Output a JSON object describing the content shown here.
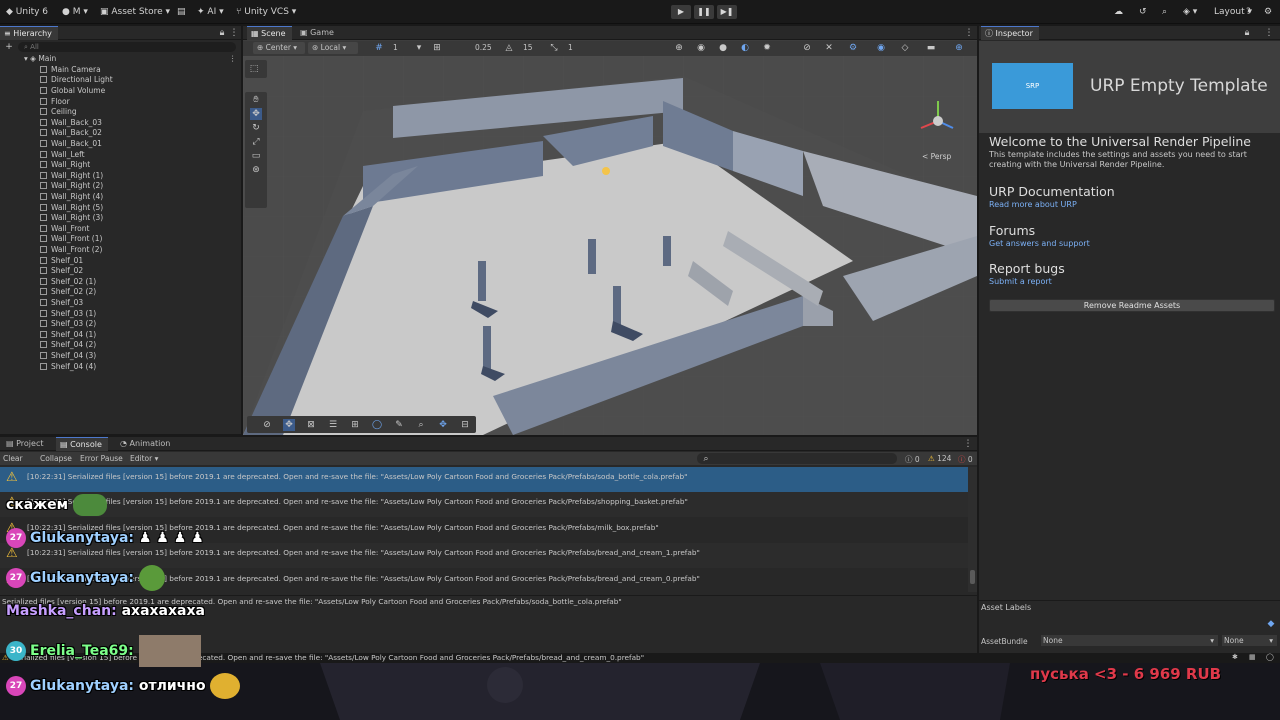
{
  "topbar": {
    "account": "Unity 6",
    "user": "M",
    "asset_store": "Asset Store",
    "ai": "AI",
    "vcs": "Unity VCS",
    "layout": "Layout"
  },
  "hierarchy": {
    "tab": "Hierarchy",
    "search_placeholder": "All",
    "scene": "Main",
    "items": [
      "Main Camera",
      "Directional Light",
      "Global Volume",
      "Floor",
      "Ceiling",
      "Wall_Back_03",
      "Wall_Back_02",
      "Wall_Back_01",
      "Wall_Left",
      "Wall_Right",
      "Wall_Right (1)",
      "Wall_Right (2)",
      "Wall_Right (4)",
      "Wall_Right (5)",
      "Wall_Right (3)",
      "Wall_Front",
      "Wall_Front (1)",
      "Wall_Front (2)",
      "Shelf_01",
      "Shelf_02",
      "Shelf_02 (1)",
      "Shelf_02 (2)",
      "Shelf_03",
      "Shelf_03 (1)",
      "Shelf_03 (2)",
      "Shelf_04 (1)",
      "Shelf_04 (2)",
      "Shelf_04 (3)",
      "Shelf_04 (4)"
    ]
  },
  "scene_view": {
    "tab_scene": "Scene",
    "tab_game": "Game",
    "pivot": "Center",
    "space": "Local",
    "grid_value": "1",
    "snap_value": "0.25",
    "rotate_value": "15",
    "scale_value": "1",
    "persp": "< Persp"
  },
  "inspector": {
    "tab": "Inspector",
    "thumb_label": "SRP",
    "title": "URP Empty Template",
    "welcome_heading": "Welcome to the Universal Render Pipeline",
    "welcome_body": "This template includes the settings and assets you need to start creating with the Universal Render Pipeline.",
    "sections": [
      {
        "heading": "URP Documentation",
        "link": "Read more about URP"
      },
      {
        "heading": "Forums",
        "link": "Get answers and support"
      },
      {
        "heading": "Report bugs",
        "link": "Submit a report"
      }
    ],
    "remove_button": "Remove Readme Assets",
    "asset_labels": "Asset Labels",
    "asset_bundle_label": "AssetBundle",
    "asset_bundle_value": "None",
    "asset_variant_value": "None"
  },
  "console": {
    "tab_project": "Project",
    "tab_console": "Console",
    "tab_animation": "Animation",
    "clear": "Clear",
    "collapse": "Collapse",
    "error_pause": "Error Pause",
    "editor": "Editor",
    "count_info": "0",
    "count_warn": "124",
    "count_error": "0",
    "messages": [
      "[10:22:31] Serialized files [version 15] before 2019.1 are deprecated. Open and re-save the file: \"Assets/Low Poly Cartoon Food and Groceries Pack/Prefabs/soda_bottle_cola.prefab\"",
      "[10:22:31] Serialized files [version 15] before 2019.1 are deprecated. Open and re-save the file: \"Assets/Low Poly Cartoon Food and Groceries Pack/Prefabs/shopping_basket.prefab\"",
      "[10:22:31] Serialized files [version 15] before 2019.1 are deprecated. Open and re-save the file: \"Assets/Low Poly Cartoon Food and Groceries Pack/Prefabs/milk_box.prefab\"",
      "[10:22:31] Serialized files [version 15] before 2019.1 are deprecated. Open and re-save the file: \"Assets/Low Poly Cartoon Food and Groceries Pack/Prefabs/bread_and_cream_1.prefab\"",
      "[10:22:31] Serialized files [version 15] before 2019.1 are deprecated. Open and re-save the file: \"Assets/Low Poly Cartoon Food and Groceries Pack/Prefabs/bread_and_cream_0.prefab\""
    ],
    "detail": "Serialized files [version 15] before 2019.1 are deprecated. Open and re-save the file: \"Assets/Low Poly Cartoon Food and Groceries Pack/Prefabs/soda_bottle_cola.prefab\"",
    "status": "Serialized files [version 15] before 2019.1 are deprecated. Open and re-save the file: \"Assets/Low Poly Cartoon Food and Groceries Pack/Prefabs/bread_and_cream_0.prefab\""
  },
  "chat": {
    "msg1_text": "скажем",
    "msg2_badge": "27",
    "msg2_user": "Glukanytaya:",
    "msg3_badge": "27",
    "msg3_user": "Glukanytaya:",
    "msg4_user": "Mashka_chan:",
    "msg4_text": "ахахахаха",
    "msg5_badge": "30",
    "msg5_user": "Erelia_Tea69:",
    "msg6_badge": "27",
    "msg6_user": "Glukanytaya:",
    "msg6_text": "отлично",
    "donation": "пуська <3 - 6 969 RUB"
  },
  "colors": {
    "accent": "#4d78cc",
    "selected_row": "#2c5d87",
    "link": "#7bb0f5",
    "donation": "#e0394a",
    "chat_badge": "#d946b9"
  }
}
